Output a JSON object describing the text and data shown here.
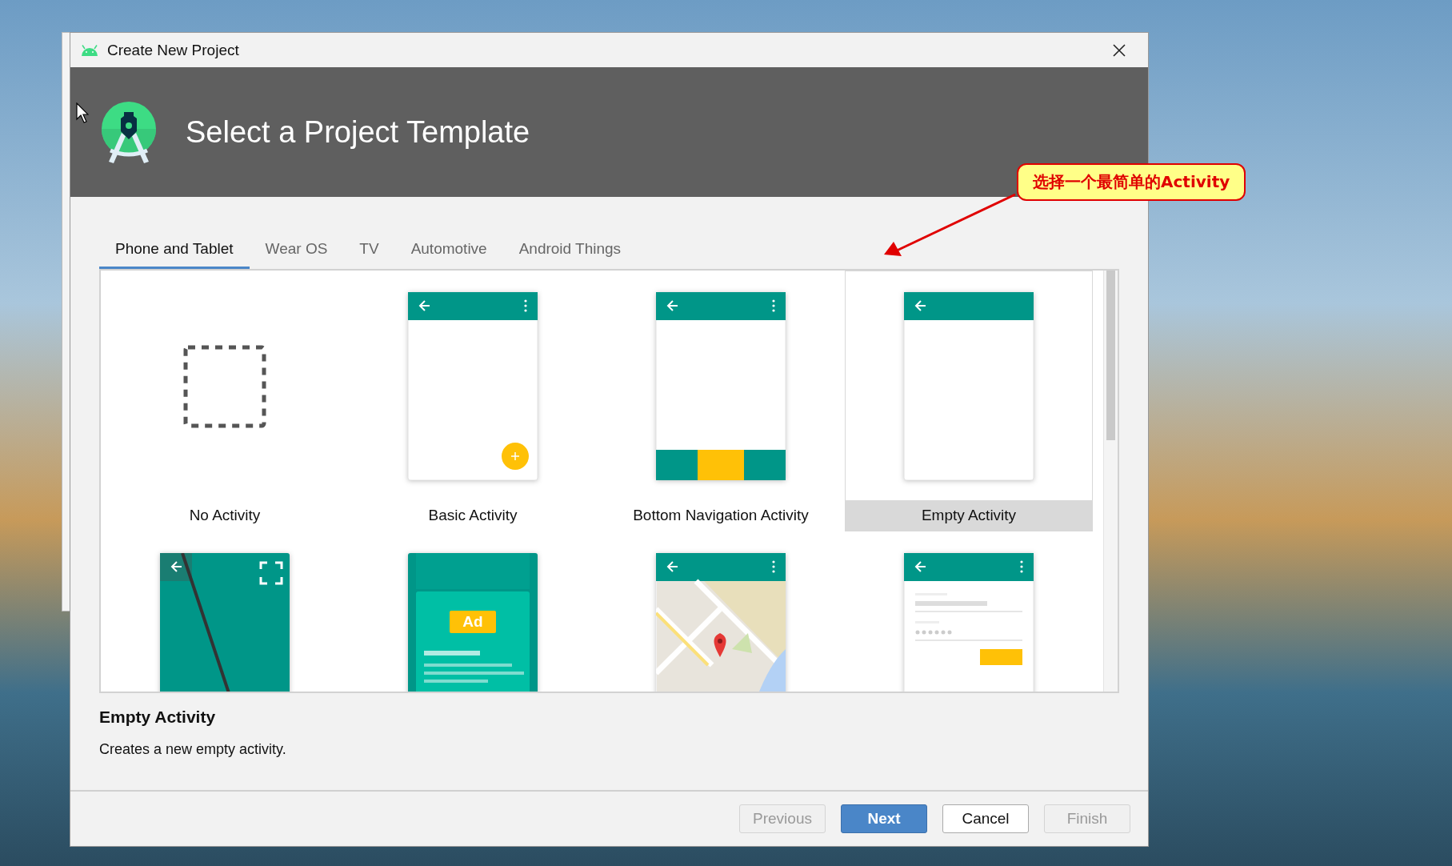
{
  "window": {
    "title": "Create New Project"
  },
  "header": {
    "title": "Select a Project Template"
  },
  "tabs": [
    {
      "label": "Phone and Tablet",
      "selected": true
    },
    {
      "label": "Wear OS",
      "selected": false
    },
    {
      "label": "TV",
      "selected": false
    },
    {
      "label": "Automotive",
      "selected": false
    },
    {
      "label": "Android Things",
      "selected": false
    }
  ],
  "templates": [
    {
      "kind": "none",
      "name": "No Activity",
      "selected": false
    },
    {
      "kind": "basic",
      "name": "Basic Activity",
      "selected": false
    },
    {
      "kind": "bottom-nav",
      "name": "Bottom Navigation Activity",
      "selected": false
    },
    {
      "kind": "empty",
      "name": "Empty Activity",
      "selected": true
    },
    {
      "kind": "fullscreen",
      "selected": false
    },
    {
      "kind": "ad",
      "preview_text": "Ad",
      "selected": false
    },
    {
      "kind": "map",
      "selected": false
    },
    {
      "kind": "login",
      "selected": false
    }
  ],
  "description": {
    "title": "Empty Activity",
    "text": "Creates a new empty activity."
  },
  "buttons": [
    {
      "label": "Previous",
      "kind": "default",
      "disabled": true
    },
    {
      "label": "Next",
      "kind": "primary",
      "disabled": false
    },
    {
      "label": "Cancel",
      "kind": "default",
      "disabled": false
    },
    {
      "label": "Finish",
      "kind": "default",
      "disabled": true
    }
  ],
  "annotation": {
    "text": "选择一个最简单的Activity"
  }
}
